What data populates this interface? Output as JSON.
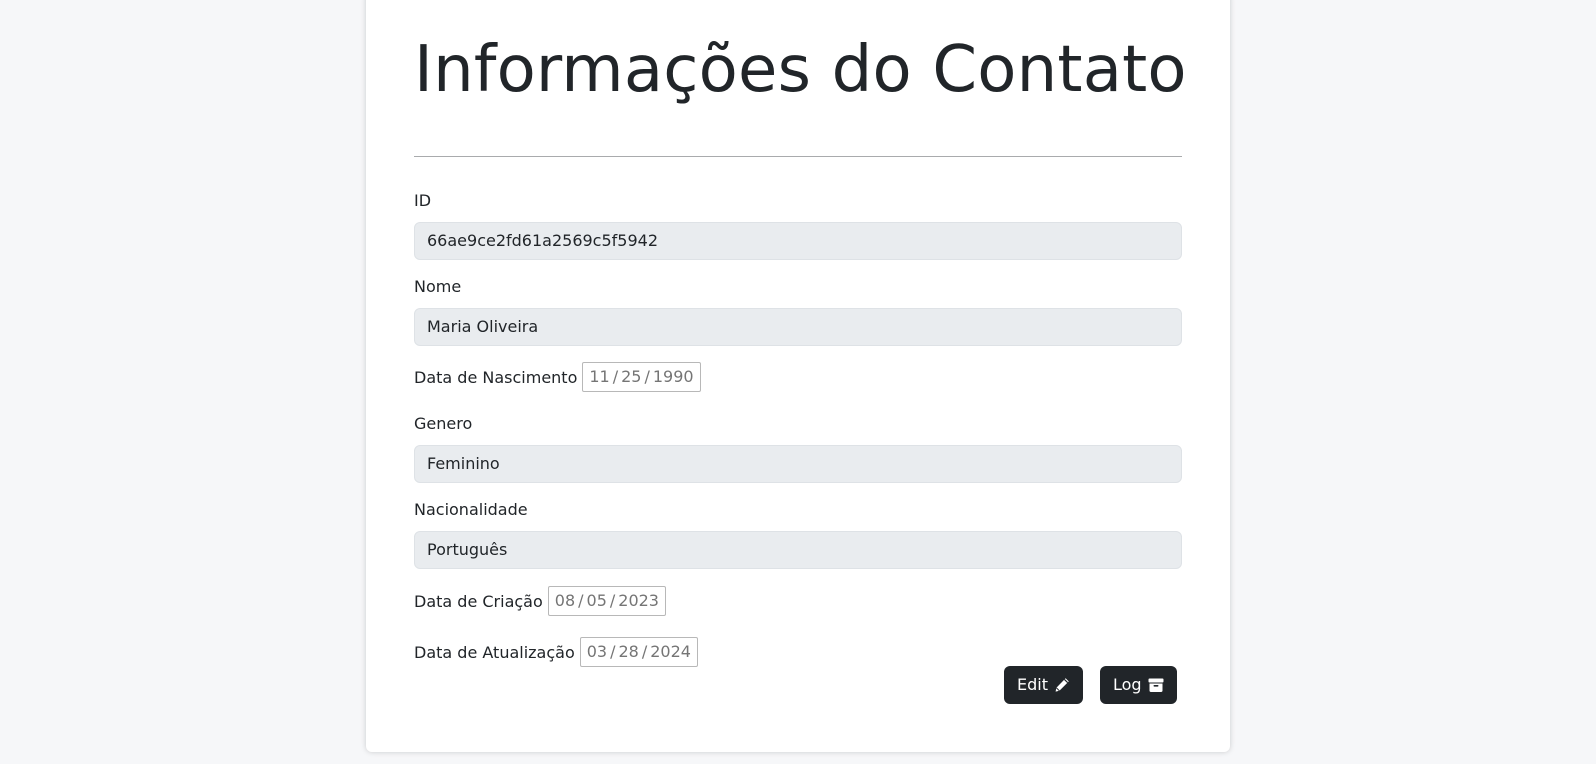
{
  "page": {
    "title": "Informações do Contato"
  },
  "fields": {
    "id": {
      "label": "ID",
      "value": "66ae9ce2fd61a2569c5f5942"
    },
    "nome": {
      "label": "Nome",
      "value": "Maria Oliveira"
    },
    "nascimento": {
      "label": "Data de Nascimento",
      "month": "11",
      "day": "25",
      "year": "1990"
    },
    "genero": {
      "label": "Genero",
      "value": "Feminino"
    },
    "nacionalidade": {
      "label": "Nacionalidade",
      "value": "Português"
    },
    "criacao": {
      "label": "Data de Criação",
      "month": "08",
      "day": "05",
      "year": "2023"
    },
    "atualizacao": {
      "label": "Data de Atualização",
      "month": "03",
      "day": "28",
      "year": "2024"
    }
  },
  "date_separator": "/",
  "actions": {
    "edit": {
      "label": "Edit",
      "icon": "pencil-icon"
    },
    "log": {
      "label": "Log",
      "icon": "archive-box-icon"
    }
  },
  "colors": {
    "button_bg": "#212529",
    "field_bg": "#e9ecef",
    "page_bg": "#f6f7f9"
  }
}
